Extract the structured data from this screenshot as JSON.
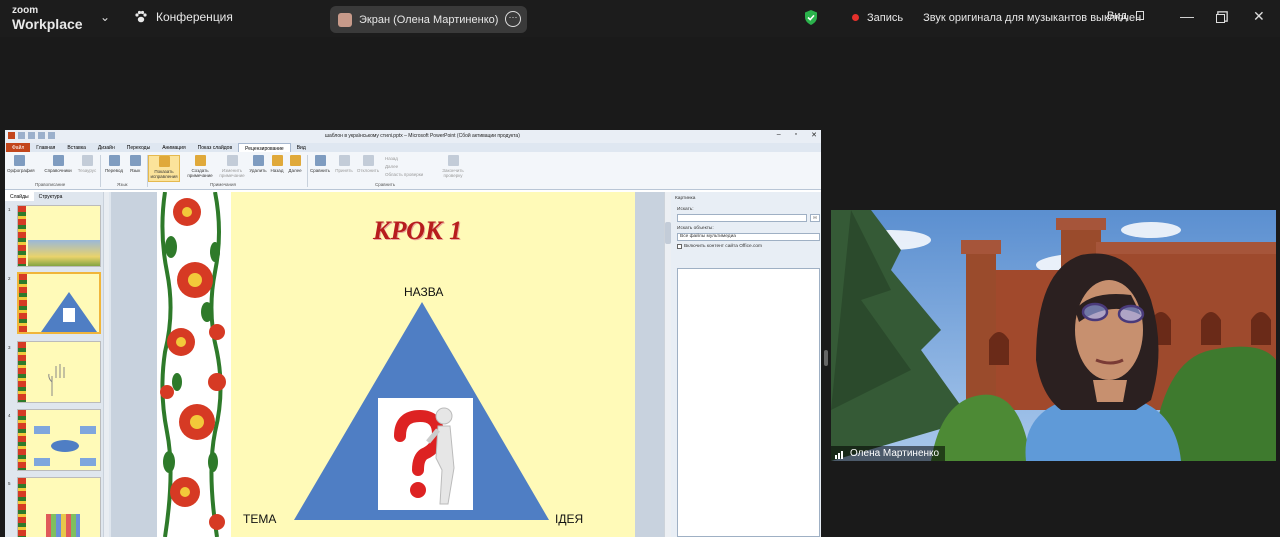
{
  "app": {
    "brand_line1": "zoom",
    "brand_line2": "Workplace"
  },
  "header": {
    "meeting_label": "Конференция",
    "screen_share_label": "Экран (Олена Мартиненко)",
    "recording_label": "Запись",
    "original_sound_label": "Звук оригинала для музыкантов выключен",
    "view_label": "Вид"
  },
  "ppt": {
    "window_title": "шаблон в українському стилі.pptx  –  Microsoft PowerPoint (Сбой активации продукта)",
    "tabs": [
      "Файл",
      "Главная",
      "Вставка",
      "Дизайн",
      "Переходы",
      "Анимация",
      "Показ слайдов",
      "Рецензирование",
      "Вид"
    ],
    "ribbon": {
      "spelling": "Орфография",
      "references": "Справочники",
      "thesaurus": "Тезаурус",
      "translate": "Перевод",
      "language": "Язык",
      "show_corrections": "Показать исправления",
      "new_comment": "Создать примечание",
      "edit_comment": "Изменить примечание",
      "delete": "Удалить",
      "previous": "Назад",
      "next": "Далее",
      "compare": "Сравнить",
      "accept": "Принять",
      "reject": "Отклонить",
      "prev2": "Назад",
      "next2": "Далее",
      "reviewing_pane": "Область проверки",
      "end_review": "Закончить проверку",
      "group_proofing": "Правописание",
      "group_language": "Язык",
      "group_comments": "Примечания",
      "group_compare": "Сравнить"
    },
    "left_tabs": [
      "Слайды",
      "Структура"
    ],
    "slide_numbers": [
      "1",
      "2",
      "3",
      "4",
      "5"
    ],
    "slide": {
      "title": "КРОК 1",
      "top_label": "НАЗВА",
      "left_label": "ТЕМА",
      "right_label": "ІДЕЯ"
    },
    "clipart_pane": {
      "title": "Картинка",
      "search_label": "Искать:",
      "search_btn": "Н",
      "objects_label": "Искать объекты:",
      "objects_value": "Все файлы мультимедиа",
      "office_checkbox": "Включить контент сайта Office.com"
    }
  },
  "video": {
    "participant_name": "Олена Мартиненко"
  },
  "colors": {
    "triangle": "#4f7ec4",
    "title_red": "#b71d1d",
    "slide_bg": "#fffab8",
    "record": "#e5302b",
    "shield": "#2bb24c"
  }
}
